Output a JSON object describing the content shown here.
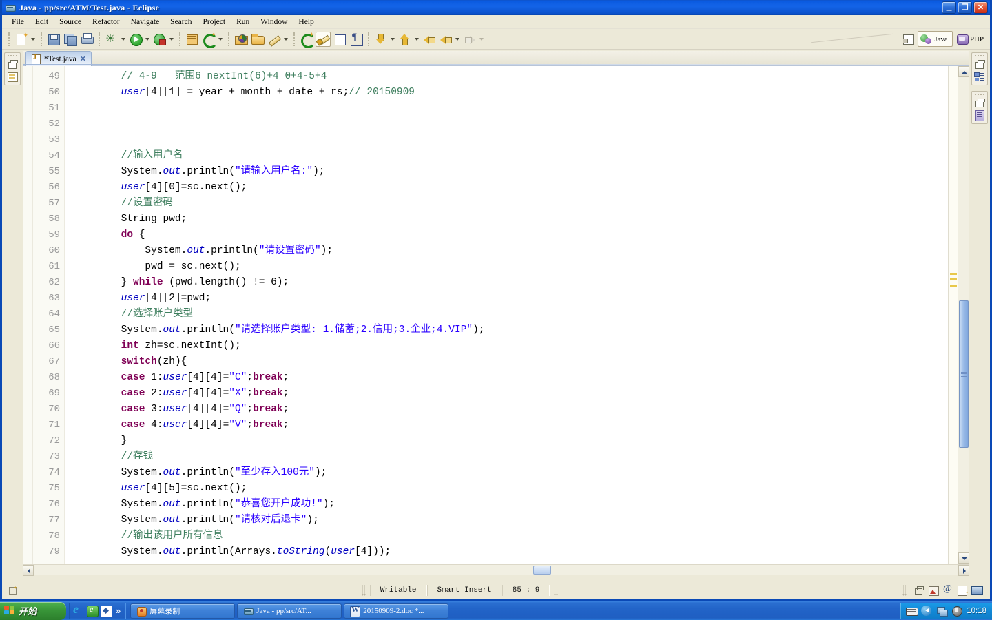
{
  "window": {
    "title": "Java - pp/src/ATM/Test.java - Eclipse",
    "icon": "eclipse-icon",
    "minimize_label": "_",
    "maximize_label": "❐",
    "close_label": "✕"
  },
  "menubar": {
    "items": [
      {
        "label": "File"
      },
      {
        "label": "Edit"
      },
      {
        "label": "Source"
      },
      {
        "label": "Refactor"
      },
      {
        "label": "Navigate"
      },
      {
        "label": "Search"
      },
      {
        "label": "Project"
      },
      {
        "label": "Run"
      },
      {
        "label": "Window"
      },
      {
        "label": "Help"
      }
    ]
  },
  "toolbar": {
    "buttons": [
      {
        "name": "new-wizard-button",
        "icon": "new-document-icon",
        "dropdown": true
      },
      {
        "name": "save-button",
        "icon": "save-icon",
        "dropdown": false
      },
      {
        "name": "save-all-button",
        "icon": "save-all-icon",
        "dropdown": false
      },
      {
        "name": "print-button",
        "icon": "print-icon",
        "dropdown": false
      },
      {
        "name": "debug-button",
        "icon": "debug-bug-icon",
        "dropdown": true
      },
      {
        "name": "run-button",
        "icon": "run-play-icon",
        "dropdown": true
      },
      {
        "name": "external-tools-button",
        "icon": "external-tools-icon",
        "dropdown": true
      },
      {
        "name": "new-java-class-button",
        "icon": "new-java-class-icon",
        "dropdown": false
      },
      {
        "name": "new-java-project-button",
        "icon": "new-java-project-icon",
        "dropdown": true
      },
      {
        "name": "open-type-button",
        "icon": "open-type-folder-icon",
        "dropdown": false
      },
      {
        "name": "open-task-button",
        "icon": "open-folder-icon",
        "dropdown": false
      },
      {
        "name": "annotation-button",
        "icon": "pencil-icon",
        "dropdown": true
      },
      {
        "name": "toggle-mark-occurrences-button",
        "icon": "mark-occurrences-icon",
        "dropdown": false
      },
      {
        "name": "toggle-block-selection-button",
        "icon": "brush-icon",
        "dropdown": false,
        "active": true
      },
      {
        "name": "show-whitespace-button",
        "icon": "show-lines-icon",
        "dropdown": false
      },
      {
        "name": "show-pilcrow-button",
        "icon": "pilcrow-icon",
        "dropdown": false
      },
      {
        "name": "next-annotation-button",
        "icon": "arrow-down-icon",
        "dropdown": true
      },
      {
        "name": "previous-annotation-button",
        "icon": "arrow-up-icon",
        "dropdown": true
      },
      {
        "name": "last-edit-location-button",
        "icon": "last-edit-icon",
        "dropdown": false
      },
      {
        "name": "back-button",
        "icon": "arrow-back-icon",
        "dropdown": true
      },
      {
        "name": "forward-button",
        "icon": "arrow-forward-icon",
        "dropdown": true,
        "disabled": true
      }
    ],
    "perspectives": {
      "open_perspective_icon": "open-perspective-icon",
      "items": [
        {
          "label": "Java",
          "icon": "java-perspective-icon",
          "selected": true
        },
        {
          "label": "PHP",
          "icon": "php-perspective-icon",
          "selected": false
        }
      ]
    }
  },
  "left_trim": {
    "stacks": [
      {
        "name": "package-explorer-fast-view",
        "restore_icon": "restore-icon",
        "view_icon": "package-explorer-icon"
      }
    ]
  },
  "right_trim": {
    "stacks": [
      {
        "name": "outline-fast-view",
        "restore_icon": "restore-icon",
        "view_icon": "outline-icon"
      },
      {
        "name": "document-fast-view",
        "restore_icon": "restore-icon",
        "view_icon": "document-icon"
      }
    ]
  },
  "editor": {
    "tab": {
      "label": "*Test.java",
      "icon": "java-file-icon",
      "close_label": "✕",
      "dirty": true
    },
    "first_line_number": 49,
    "lines": [
      {
        "n": 49,
        "tokens": [
          {
            "t": "        ",
            "c": ""
          },
          {
            "t": "// 4-9   范围6 nextInt(6)+4 0+4-5+4",
            "c": "cmt"
          }
        ]
      },
      {
        "n": 50,
        "tokens": [
          {
            "t": "        ",
            "c": ""
          },
          {
            "t": "user",
            "c": "fld"
          },
          {
            "t": "[4][1] = year + month + date + rs;",
            "c": ""
          },
          {
            "t": "// 20150909",
            "c": "cmt"
          }
        ]
      },
      {
        "n": 51,
        "tokens": []
      },
      {
        "n": 52,
        "tokens": []
      },
      {
        "n": 53,
        "tokens": []
      },
      {
        "n": 54,
        "tokens": [
          {
            "t": "        ",
            "c": ""
          },
          {
            "t": "//输入用户名",
            "c": "cmt"
          }
        ]
      },
      {
        "n": 55,
        "tokens": [
          {
            "t": "        System.",
            "c": ""
          },
          {
            "t": "out",
            "c": "stc"
          },
          {
            "t": ".println(",
            "c": ""
          },
          {
            "t": "\"请输入用户名:\"",
            "c": "str"
          },
          {
            "t": ");",
            "c": ""
          }
        ]
      },
      {
        "n": 56,
        "tokens": [
          {
            "t": "        ",
            "c": ""
          },
          {
            "t": "user",
            "c": "fld"
          },
          {
            "t": "[4][0]=sc.next();",
            "c": ""
          }
        ]
      },
      {
        "n": 57,
        "tokens": [
          {
            "t": "        ",
            "c": ""
          },
          {
            "t": "//设置密码",
            "c": "cmt"
          }
        ]
      },
      {
        "n": 58,
        "tokens": [
          {
            "t": "        String pwd;",
            "c": ""
          }
        ]
      },
      {
        "n": 59,
        "tokens": [
          {
            "t": "        ",
            "c": ""
          },
          {
            "t": "do",
            "c": "kw"
          },
          {
            "t": " {",
            "c": ""
          }
        ]
      },
      {
        "n": 60,
        "tokens": [
          {
            "t": "            System.",
            "c": ""
          },
          {
            "t": "out",
            "c": "stc"
          },
          {
            "t": ".println(",
            "c": ""
          },
          {
            "t": "\"请设置密码\"",
            "c": "str"
          },
          {
            "t": ");",
            "c": ""
          }
        ]
      },
      {
        "n": 61,
        "tokens": [
          {
            "t": "            pwd = sc.next();",
            "c": ""
          }
        ]
      },
      {
        "n": 62,
        "tokens": [
          {
            "t": "        } ",
            "c": ""
          },
          {
            "t": "while",
            "c": "kw"
          },
          {
            "t": " (pwd.length() != 6);",
            "c": ""
          }
        ]
      },
      {
        "n": 63,
        "tokens": [
          {
            "t": "        ",
            "c": ""
          },
          {
            "t": "user",
            "c": "fld"
          },
          {
            "t": "[4][2]=pwd;",
            "c": ""
          }
        ]
      },
      {
        "n": 64,
        "tokens": [
          {
            "t": "        ",
            "c": ""
          },
          {
            "t": "//选择账户类型",
            "c": "cmt"
          }
        ]
      },
      {
        "n": 65,
        "tokens": [
          {
            "t": "        System.",
            "c": ""
          },
          {
            "t": "out",
            "c": "stc"
          },
          {
            "t": ".println(",
            "c": ""
          },
          {
            "t": "\"请选择账户类型: 1.储蓄;2.信用;3.企业;4.VIP\"",
            "c": "str"
          },
          {
            "t": ");",
            "c": ""
          }
        ]
      },
      {
        "n": 66,
        "tokens": [
          {
            "t": "        ",
            "c": ""
          },
          {
            "t": "int",
            "c": "kw"
          },
          {
            "t": " zh=sc.nextInt();",
            "c": ""
          }
        ]
      },
      {
        "n": 67,
        "tokens": [
          {
            "t": "        ",
            "c": ""
          },
          {
            "t": "switch",
            "c": "kw"
          },
          {
            "t": "(zh){",
            "c": ""
          }
        ]
      },
      {
        "n": 68,
        "tokens": [
          {
            "t": "        ",
            "c": ""
          },
          {
            "t": "case",
            "c": "kw"
          },
          {
            "t": " 1:",
            "c": ""
          },
          {
            "t": "user",
            "c": "fld"
          },
          {
            "t": "[4][4]=",
            "c": ""
          },
          {
            "t": "\"C\"",
            "c": "str"
          },
          {
            "t": ";",
            "c": ""
          },
          {
            "t": "break",
            "c": "kw"
          },
          {
            "t": ";",
            "c": ""
          }
        ]
      },
      {
        "n": 69,
        "tokens": [
          {
            "t": "        ",
            "c": ""
          },
          {
            "t": "case",
            "c": "kw"
          },
          {
            "t": " 2:",
            "c": ""
          },
          {
            "t": "user",
            "c": "fld"
          },
          {
            "t": "[4][4]=",
            "c": ""
          },
          {
            "t": "\"X\"",
            "c": "str"
          },
          {
            "t": ";",
            "c": ""
          },
          {
            "t": "break",
            "c": "kw"
          },
          {
            "t": ";",
            "c": ""
          }
        ]
      },
      {
        "n": 70,
        "tokens": [
          {
            "t": "        ",
            "c": ""
          },
          {
            "t": "case",
            "c": "kw"
          },
          {
            "t": " 3:",
            "c": ""
          },
          {
            "t": "user",
            "c": "fld"
          },
          {
            "t": "[4][4]=",
            "c": ""
          },
          {
            "t": "\"Q\"",
            "c": "str"
          },
          {
            "t": ";",
            "c": ""
          },
          {
            "t": "break",
            "c": "kw"
          },
          {
            "t": ";",
            "c": ""
          }
        ]
      },
      {
        "n": 71,
        "tokens": [
          {
            "t": "        ",
            "c": ""
          },
          {
            "t": "case",
            "c": "kw"
          },
          {
            "t": " 4:",
            "c": ""
          },
          {
            "t": "user",
            "c": "fld"
          },
          {
            "t": "[4][4]=",
            "c": ""
          },
          {
            "t": "\"V\"",
            "c": "str"
          },
          {
            "t": ";",
            "c": ""
          },
          {
            "t": "break",
            "c": "kw"
          },
          {
            "t": ";",
            "c": ""
          }
        ]
      },
      {
        "n": 72,
        "tokens": [
          {
            "t": "        }",
            "c": ""
          }
        ]
      },
      {
        "n": 73,
        "tokens": [
          {
            "t": "        ",
            "c": ""
          },
          {
            "t": "//存钱",
            "c": "cmt"
          }
        ]
      },
      {
        "n": 74,
        "tokens": [
          {
            "t": "        System.",
            "c": ""
          },
          {
            "t": "out",
            "c": "stc"
          },
          {
            "t": ".println(",
            "c": ""
          },
          {
            "t": "\"至少存入100元\"",
            "c": "str"
          },
          {
            "t": ");",
            "c": ""
          }
        ]
      },
      {
        "n": 75,
        "tokens": [
          {
            "t": "        ",
            "c": ""
          },
          {
            "t": "user",
            "c": "fld"
          },
          {
            "t": "[4][5]=sc.next();",
            "c": ""
          }
        ]
      },
      {
        "n": 76,
        "tokens": [
          {
            "t": "        System.",
            "c": ""
          },
          {
            "t": "out",
            "c": "stc"
          },
          {
            "t": ".println(",
            "c": ""
          },
          {
            "t": "\"恭喜您开户成功!\"",
            "c": "str"
          },
          {
            "t": ");",
            "c": ""
          }
        ]
      },
      {
        "n": 77,
        "tokens": [
          {
            "t": "        System.",
            "c": ""
          },
          {
            "t": "out",
            "c": "stc"
          },
          {
            "t": ".println(",
            "c": ""
          },
          {
            "t": "\"请核对后退卡\"",
            "c": "str"
          },
          {
            "t": ");",
            "c": ""
          }
        ]
      },
      {
        "n": 78,
        "tokens": [
          {
            "t": "        ",
            "c": ""
          },
          {
            "t": "//输出该用户所有信息",
            "c": "cmt"
          }
        ]
      },
      {
        "n": 79,
        "tokens": [
          {
            "t": "        System.",
            "c": ""
          },
          {
            "t": "out",
            "c": "stc"
          },
          {
            "t": ".println(Arrays.",
            "c": ""
          },
          {
            "t": "toString",
            "c": "stc"
          },
          {
            "t": "(",
            "c": ""
          },
          {
            "t": "user",
            "c": "fld"
          },
          {
            "t": "[4]));",
            "c": ""
          }
        ]
      }
    ],
    "vertical_scrollbar": {
      "name": "editor-vertical-scrollbar",
      "thumb_top_pct": 47,
      "thumb_height_pct": 31
    },
    "horizontal_scrollbar": {
      "name": "editor-horizontal-scrollbar"
    }
  },
  "statusbar": {
    "writable": "Writable",
    "insert_mode": "Smart Insert",
    "position": "85 : 9",
    "icons": [
      {
        "name": "restore-icon"
      },
      {
        "name": "image-thumbnail-icon"
      },
      {
        "name": "at-sign-icon"
      },
      {
        "name": "page-edit-icon"
      },
      {
        "name": "monitor-icon"
      }
    ]
  },
  "taskbar": {
    "start_label": "开始",
    "quick_launch": [
      {
        "name": "internet-explorer-icon"
      },
      {
        "name": "green-browser-icon"
      },
      {
        "name": "blue-app-icon"
      },
      {
        "name": "quick-launch-chevron-icon",
        "label": "»"
      }
    ],
    "tasks": [
      {
        "label": "屏幕录制",
        "icon": "screen-recorder-icon",
        "active": false
      },
      {
        "label": "Java - pp/src/AT...",
        "icon": "eclipse-icon",
        "active": true
      },
      {
        "label": "20150909-2.doc *...",
        "icon": "word-document-icon",
        "active": false
      }
    ],
    "tray": {
      "icons": [
        {
          "name": "keyboard-ime-icon"
        },
        {
          "name": "show-hidden-icons-icon"
        },
        {
          "name": "network-icon"
        },
        {
          "name": "volume-icon"
        }
      ],
      "clock": "10:18"
    }
  },
  "colors": {
    "title_blue": "#0a5ae0",
    "chrome": "#ece9d8",
    "editor_bg": "#ffffff",
    "comment": "#3f7f5f",
    "keyword": "#7f0055",
    "string": "#2a00ff",
    "field": "#0000c0",
    "taskbar_blue": "#2264c8",
    "start_green": "#399639"
  }
}
